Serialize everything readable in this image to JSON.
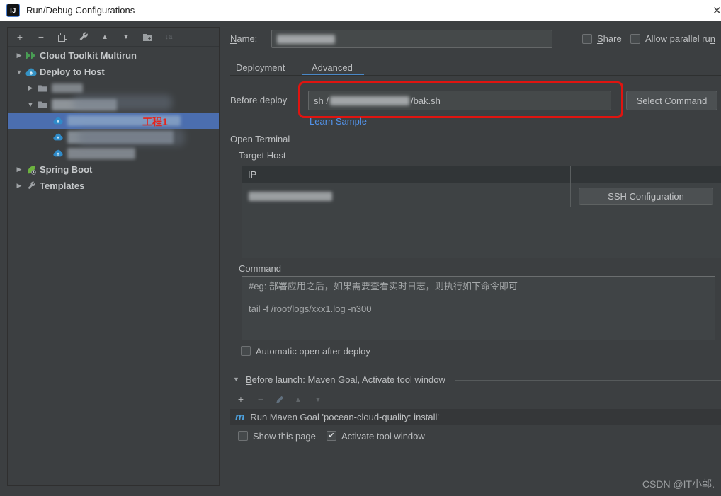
{
  "window": {
    "title": "Run/Debug Configurations",
    "icon_text": "IJ",
    "close_glyph": "✕"
  },
  "colors": {
    "selection_blue": "#4b6eaf",
    "tab_underline_blue": "#4a88c7",
    "link_blue": "#5394ec",
    "annotation_red": "#e01410",
    "maven_blue": "#4d9fdb",
    "titlebar_bg": "#ffffff",
    "dialog_bg": "#3c3f41"
  },
  "sidebar": {
    "toolbar": {
      "add": "+",
      "remove": "−",
      "copy": "copy-icon",
      "settings": "wrench-icon",
      "move_up": "▲",
      "move_down": "▼",
      "new_folder": "folder-plus-icon",
      "sort": "↓a"
    },
    "tree": [
      {
        "arrow": "▶",
        "label": "Cloud Toolkit Multirun"
      },
      {
        "arrow": "▼",
        "label": "Deploy to Host"
      },
      {
        "arrow": "▶",
        "label": ""
      },
      {
        "arrow": "▼",
        "label": ""
      },
      {
        "arrow": "",
        "label": "",
        "annotation": "工程1",
        "selected": true
      },
      {
        "arrow": "",
        "label": ""
      },
      {
        "arrow": "",
        "label": ""
      },
      {
        "arrow": "▶",
        "label": "Spring Boot"
      },
      {
        "arrow": "▶",
        "label": "Templates"
      }
    ]
  },
  "main": {
    "name": {
      "initial": "N",
      "rest": "ame:"
    },
    "share": {
      "initial": "S",
      "rest": "hare"
    },
    "allow_parallel": {
      "head": "Allow parallel ru",
      "tail": "n"
    },
    "tabs": [
      {
        "label": "Deployment"
      },
      {
        "label": "Advanced"
      }
    ],
    "before_deploy": {
      "label": "Before deploy",
      "value_prefix": "sh /",
      "value_suffix": "/bak.sh",
      "select_button": "Select Command",
      "link": "Learn Sample"
    },
    "open_terminal_label": "Open Terminal",
    "target_host_label": "Target Host",
    "host_table": {
      "ip_header": "IP",
      "ssh_button": "SSH Configuration"
    },
    "command": {
      "label": "Command",
      "line1": "#eg: 部署应用之后，如果需要查看实时日志，则执行如下命令即可",
      "line2": "tail -f /root/logs/xxx1.log -n300"
    },
    "auto_open_label": "Automatic open after deploy",
    "before_launch": {
      "collapse_glyph": "▼",
      "initial": "B",
      "rest": "efore launch: Maven Goal, Activate tool window",
      "toolbar": {
        "add": "+",
        "remove": "−",
        "move_up": "▲",
        "move_down": "▼"
      }
    },
    "maven_task": {
      "icon_text": "m",
      "label": "Run Maven Goal 'pocean-cloud-quality: install'"
    },
    "show_this_page_label": "Show this page",
    "activate_tool_window_label": "Activate tool window",
    "check_glyph": "✔"
  },
  "watermark": "CSDN @IT小郭."
}
